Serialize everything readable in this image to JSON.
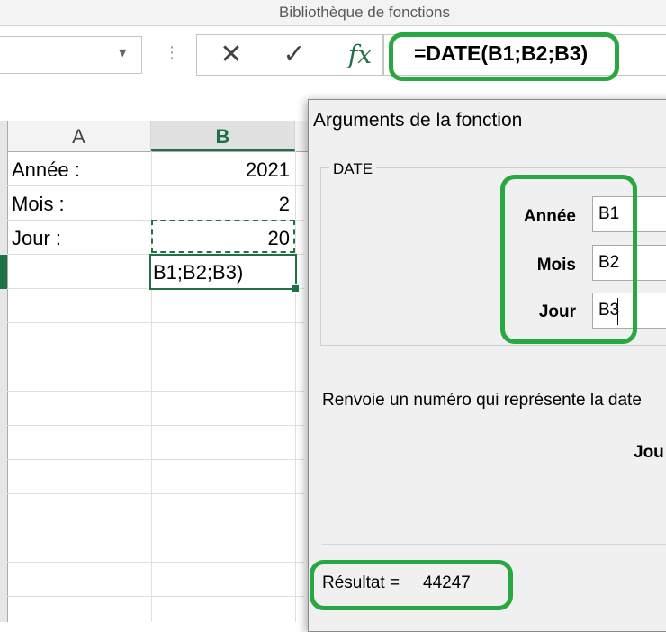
{
  "ribbon": {
    "group_label": "Bibliothèque de fonctions"
  },
  "formula_bar": {
    "cancel_glyph": "✕",
    "enter_glyph": "✓",
    "fx_label": "fx",
    "formula": "=DATE(B1;B2;B3)"
  },
  "sheet": {
    "columns": [
      "A",
      "B"
    ],
    "active_column": "B",
    "rows": [
      {
        "a": "Année :",
        "b": "2021"
      },
      {
        "a": "Mois :",
        "b": "2"
      },
      {
        "a": "Jour :",
        "b": "20"
      }
    ],
    "editing_cell_text": "B1;B2;B3)"
  },
  "dialog": {
    "title": "Arguments de la fonction",
    "function_name": "DATE",
    "arguments": [
      {
        "label": "Année",
        "value": "B1"
      },
      {
        "label": "Mois",
        "value": "B2"
      },
      {
        "label": "Jour",
        "value": "B3"
      }
    ],
    "description": "Renvoie un numéro qui représente la date",
    "current_param": "Jou",
    "result_label": "Résultat =",
    "result_value": "44247"
  },
  "colors": {
    "excel_green": "#1e7145",
    "highlight_green": "#27a841"
  },
  "icons": [
    "cancel-icon",
    "check-icon",
    "fx-icon",
    "dropdown-chevron-icon",
    "grip-dots-icon"
  ]
}
